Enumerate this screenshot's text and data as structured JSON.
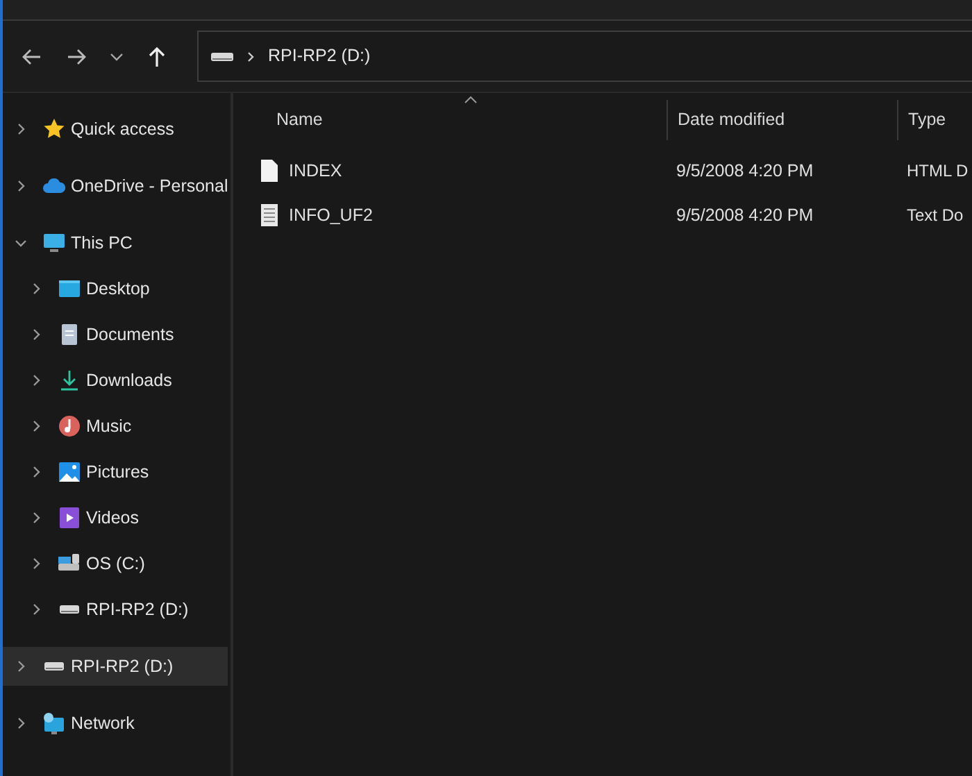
{
  "address_bar": {
    "path": "RPI-RP2 (D:)"
  },
  "sidebar": {
    "items": [
      {
        "label": "Quick access",
        "expanded": false,
        "selected": false
      },
      {
        "label": "OneDrive - Personal",
        "expanded": false,
        "selected": false
      },
      {
        "label": "This PC",
        "expanded": true,
        "selected": false,
        "children": [
          {
            "label": "Desktop",
            "expanded": false,
            "selected": false
          },
          {
            "label": "Documents",
            "expanded": false,
            "selected": false
          },
          {
            "label": "Downloads",
            "expanded": false,
            "selected": false
          },
          {
            "label": "Music",
            "expanded": false,
            "selected": false
          },
          {
            "label": "Pictures",
            "expanded": false,
            "selected": false
          },
          {
            "label": "Videos",
            "expanded": false,
            "selected": false
          },
          {
            "label": "OS (C:)",
            "expanded": false,
            "selected": false
          },
          {
            "label": "RPI-RP2 (D:)",
            "expanded": false,
            "selected": false
          }
        ]
      },
      {
        "label": "RPI-RP2 (D:)",
        "expanded": false,
        "selected": true
      },
      {
        "label": "Network",
        "expanded": false,
        "selected": false
      }
    ]
  },
  "file_list": {
    "columns": [
      "Name",
      "Date modified",
      "Type"
    ],
    "rows": [
      {
        "kind": "html",
        "name": "INDEX",
        "date_modified": "9/5/2008 4:20 PM",
        "type": "HTML D"
      },
      {
        "kind": "text",
        "name": "INFO_UF2",
        "date_modified": "9/5/2008 4:20 PM",
        "type": "Text Do"
      }
    ]
  }
}
